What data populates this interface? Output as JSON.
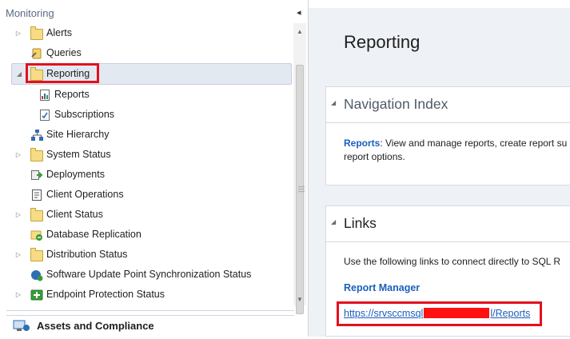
{
  "nav": {
    "header": "Monitoring",
    "collapse_glyph": "◂",
    "items": [
      {
        "label": "Alerts",
        "icon": "folder-icon",
        "expandable": true
      },
      {
        "label": "Queries",
        "icon": "queries-icon",
        "expandable": false
      },
      {
        "label": "Reporting",
        "icon": "folder-icon",
        "expandable": true,
        "expanded": true,
        "selected": true
      },
      {
        "label": "Reports",
        "icon": "report-icon",
        "expandable": false
      },
      {
        "label": "Subscriptions",
        "icon": "subscription-icon",
        "expandable": false
      },
      {
        "label": "Site Hierarchy",
        "icon": "hierarchy-icon",
        "expandable": false
      },
      {
        "label": "System Status",
        "icon": "folder-icon",
        "expandable": true
      },
      {
        "label": "Deployments",
        "icon": "deployments-icon",
        "expandable": false
      },
      {
        "label": "Client Operations",
        "icon": "client-operations-icon",
        "expandable": false
      },
      {
        "label": "Client Status",
        "icon": "folder-icon",
        "expandable": true
      },
      {
        "label": "Database Replication",
        "icon": "database-replication-icon",
        "expandable": false
      },
      {
        "label": "Distribution Status",
        "icon": "folder-icon",
        "expandable": true
      },
      {
        "label": "Software Update Point Synchronization Status",
        "icon": "software-update-icon",
        "expandable": false
      },
      {
        "label": "Endpoint Protection Status",
        "icon": "folder-green-icon",
        "expandable": true
      }
    ],
    "workspace": "Assets and Compliance"
  },
  "content": {
    "title": "Reporting",
    "nav_index": {
      "title": "Navigation Index",
      "link": "Reports",
      "text": ": View and manage reports, create report su",
      "text2": "report options."
    },
    "links": {
      "title": "Links",
      "text": "Use the following links to connect directly to SQL R",
      "report_manager": "Report Manager",
      "url_prefix": "https://srvsccmsql",
      "url_suffix": "l/Reports"
    }
  },
  "colors": {
    "highlight": "#e3101e",
    "link": "#1c5ebd",
    "content_bg": "#eef1f5"
  }
}
